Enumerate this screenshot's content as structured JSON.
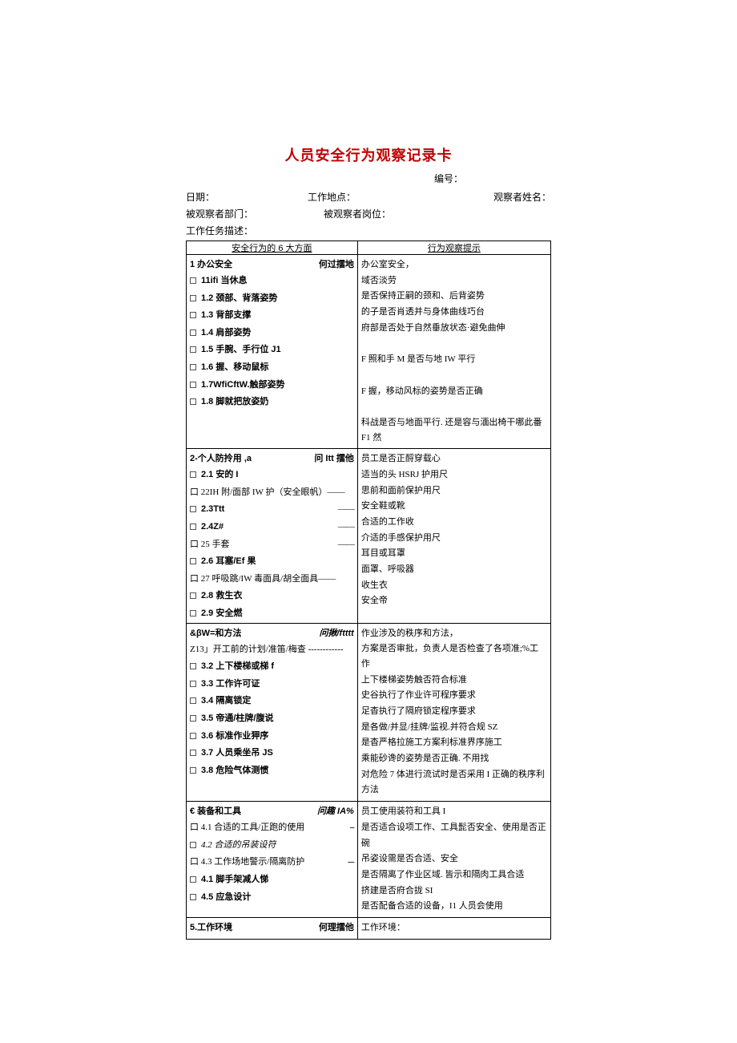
{
  "title": "人员安全行为观察记录卡",
  "number_label": "编号：",
  "meta": {
    "date_label": "日期：",
    "location_label": "工作地点：",
    "observer_label": "观察者姓名：",
    "dept_label": "被观察者部门：",
    "post_label": "被观察者岗位：",
    "task_label": "工作任务描述："
  },
  "headers": {
    "left": "安全行为的 6 大方面",
    "right": "行为观察提示"
  },
  "sections": [
    {
      "left_head": {
        "l": "1 办公安全",
        "r": "何过擂地",
        "bold": true
      },
      "left_items": [
        {
          "box": true,
          "label": "11ifi 当休息",
          "bold": true
        },
        {
          "box": true,
          "label": "1.2 颈部、背落姿势",
          "bold": true
        },
        {
          "box": true,
          "label": "1.3 背部支撑",
          "bold": true
        },
        {
          "box": true,
          "label": "1.4 肩部姿势",
          "bold": true
        },
        {
          "box": true,
          "label": "1.5 手腕、手行位 J1",
          "bold": true
        },
        {
          "box": true,
          "label": "1.6 握、移动鼠标",
          "bold": true
        },
        {
          "box": true,
          "label": "1.7WfiCftW.触部姿势",
          "bold": true
        },
        {
          "box": true,
          "label": "1.8 脚就把放姿奶",
          "bold": true
        }
      ],
      "right_lines": [
        "办公室安全，",
        "域否淡劳",
        "是否保持正嗣的颈和、后背姿势",
        "的子是否肖透并与身体曲线巧台",
        "府部是否处于自然垂放状态·避免曲伸",
        "",
        "F 照和手 M 是否与地 IW 平行",
        "",
        "F 握，移动风标的姿势是否正确",
        "",
        "科战是否与地面平行. 还是容与湎出椅干哪此番 F1 然"
      ]
    },
    {
      "left_head": {
        "l": "2-个人防拎用 ,a",
        "r": "问 Itt 擂他",
        "bold": true
      },
      "left_items": [
        {
          "box": true,
          "label": "2.1 安的 I",
          "bold": true
        },
        {
          "box": false,
          "label": "口 22IH 附/面部 IW 护（安全眼帆）——"
        },
        {
          "box": true,
          "label": "2.3Ttt",
          "bold": true,
          "dash": "——"
        },
        {
          "box": true,
          "label": "2.4Z#",
          "bold": true,
          "dash": "——"
        },
        {
          "box": false,
          "label": "口 25 手套",
          "dash": "——"
        },
        {
          "box": true,
          "label": "2.6 耳塞/Ef 果",
          "bold": true
        },
        {
          "box": false,
          "label": "口 27 呼吸跳/IW 毒面具/胡全面具——"
        },
        {
          "box": true,
          "label": "2.8 救生衣",
          "bold": true
        },
        {
          "box": true,
          "label": "2.9 安全燃",
          "bold": true
        }
      ],
      "right_lines": [
        "员工是否正酹穿载心",
        "适当的头 HSRJ 护用尺",
        "思前和面前保护用尺",
        "安全鞋或靴",
        "合适的工作收",
        "介适的手感保护用尺",
        "耳目或耳罩",
        "面罩、呼吸器",
        "收生衣",
        "安全帝"
      ]
    },
    {
      "left_head": {
        "l": "&βW=和方法",
        "r": "问揪/ftttt",
        "bold": true,
        "italic_r": true
      },
      "left_items": [
        {
          "box": false,
          "label": "Z13」开工前的计划/准笛/梅查 ------------"
        },
        {
          "box": true,
          "label": "3.2 上下楼梯或梯 f",
          "bold": true
        },
        {
          "box": true,
          "label": "3.3 工作许可证",
          "bold": true
        },
        {
          "box": true,
          "label": "3.4 隔离锁定",
          "bold": true
        },
        {
          "box": true,
          "label": "3.5 帝通/柱牌/腹说",
          "bold": true
        },
        {
          "box": true,
          "label": "3.6 标准作业狎序",
          "bold": true
        },
        {
          "box": true,
          "label": "3.7 人员乘坐吊 JS",
          "bold": true
        },
        {
          "box": true,
          "label": "3.8 危险气体测惯",
          "bold": true
        }
      ],
      "right_lines": [
        "作业涉及的秩序和方法，",
        "方案是否审批，负责人是否检查了各项准;%工作",
        "上下楼梯姿势触否符合标准",
        "史谷执行了作业许可程序要求",
        "足杳执行了隔府锁定程序要求",
        "是各做/并显/挂牌/监视.并符合规 SZ",
        "是杳严格拉施工方案利标准界序施工",
        "乘能砂谗的姿势是否正确. 不用找",
        "对危险 7 体进行流试时是否采用 I 正确的秩序利",
        "方法"
      ]
    },
    {
      "left_head": {
        "l": "€ 装备和工具",
        "r": "问趣 IA%",
        "bold": true,
        "italic_r": true
      },
      "left_items": [
        {
          "box": false,
          "label": "口 4.1 合适的工具/正跑的使用",
          "dash": "--"
        },
        {
          "box": true,
          "label": "4.2 合适的吊装设符",
          "italic": true
        },
        {
          "box": false,
          "label": "口 4.3 工作场地警示/隔离防护",
          "dash": "---"
        },
        {
          "box": true,
          "label": "4.1 脚手架减人悌",
          "bold": true
        },
        {
          "box": true,
          "label": "4.5 应急设计",
          "bold": true
        }
      ],
      "right_lines": [
        "员工使用装符和工具 I",
        "是否适合设项工作、工具髭否安全、使用是否正",
        "碗",
        "吊姿设需是否合适、安全",
        "是否隔离了作业区域. 皆示和隔肉工具合适",
        "挤建是否府合拢 SI",
        "是否配备合适的设备，I1 人员会使用"
      ]
    },
    {
      "left_head": {
        "l": "5.工作环境",
        "r": "何理擂他",
        "bold": true
      },
      "left_items": [],
      "right_lines": [
        "工作环境："
      ]
    }
  ]
}
